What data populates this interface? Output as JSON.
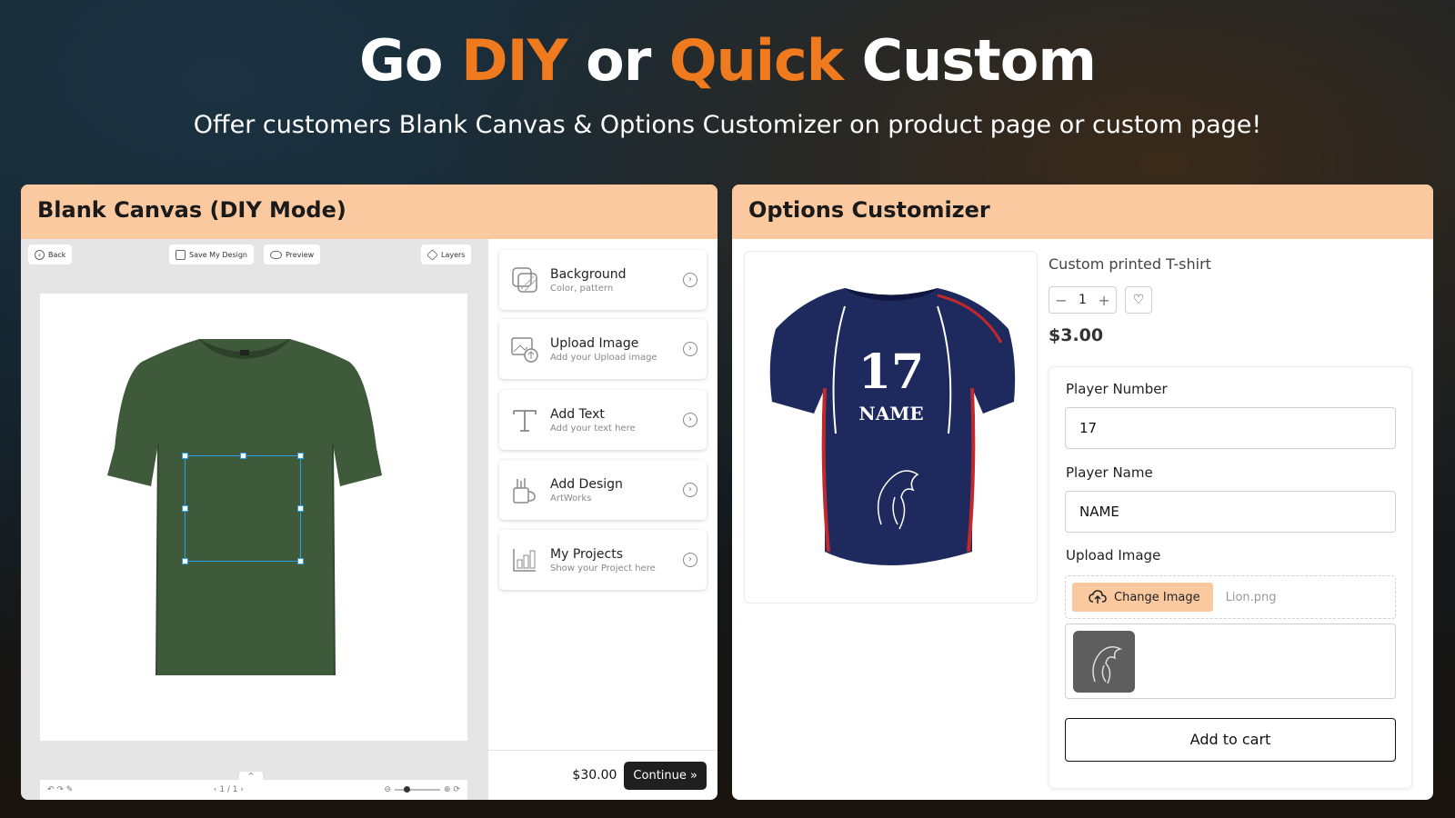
{
  "hero": {
    "title_1": "Go ",
    "title_accent_1": "DIY",
    "title_2": " or ",
    "title_accent_2": "Quick",
    "title_3": " Custom",
    "subtitle": "Offer customers Blank Canvas & Options Customizer on product page or custom page!"
  },
  "colors": {
    "accent": "#f07a1e",
    "panel_header": "#fbc9a0",
    "selection": "#2aa0e8"
  },
  "left_panel": {
    "title": "Blank Canvas (DIY Mode)",
    "toolbar": {
      "back": "Back",
      "save": "Save My Design",
      "preview": "Preview",
      "layers": "Layers"
    },
    "footer": {
      "page_indicator": "1 / 1"
    },
    "tools": [
      {
        "title": "Background",
        "subtitle": "Color, pattern",
        "icon": "background-icon"
      },
      {
        "title": "Upload Image",
        "subtitle": "Add your Upload image",
        "icon": "upload-image-icon"
      },
      {
        "title": "Add Text",
        "subtitle": "Add your text here",
        "icon": "text-icon"
      },
      {
        "title": "Add Design",
        "subtitle": "ArtWorks",
        "icon": "design-icon"
      },
      {
        "title": "My Projects",
        "subtitle": "Show your Project here",
        "icon": "projects-icon"
      }
    ],
    "price": "$30.00",
    "continue_label": "Continue"
  },
  "right_panel": {
    "title": "Options Customizer",
    "product_title": "Custom printed T-shirt",
    "quantity": "1",
    "price": "$3.00",
    "jersey": {
      "number": "17",
      "name": "NAME"
    },
    "fields": {
      "player_number_label": "Player Number",
      "player_number_value": "17",
      "player_name_label": "Player Name",
      "player_name_value": "NAME",
      "upload_label": "Upload Image",
      "change_image": "Change Image",
      "file_name": "Lion.png"
    },
    "add_to_cart": "Add to cart"
  }
}
